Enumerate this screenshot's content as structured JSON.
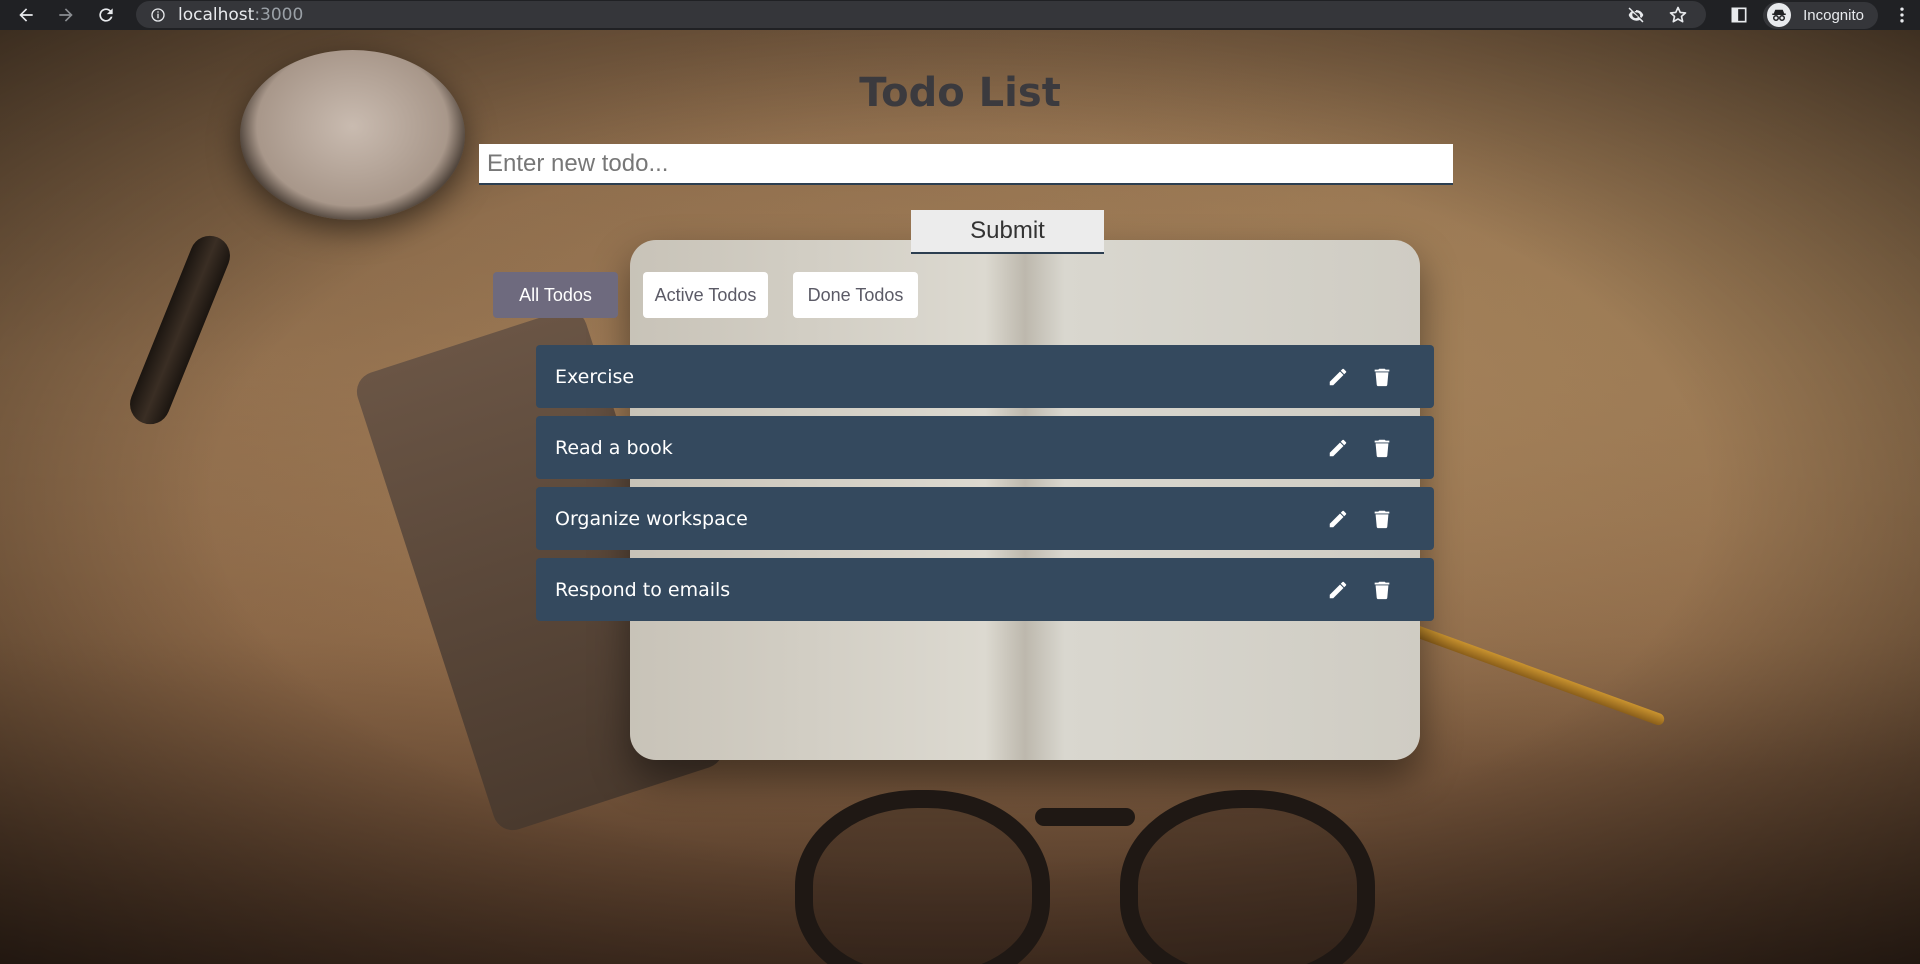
{
  "browser": {
    "url_host": "localhost",
    "url_port": ":3000",
    "profile_label": "Incognito"
  },
  "app": {
    "title": "Todo List",
    "input_placeholder": "Enter new todo...",
    "input_value": "",
    "submit_label": "Submit",
    "filters": [
      {
        "label": "All Todos",
        "active": true
      },
      {
        "label": "Active Todos",
        "active": false
      },
      {
        "label": "Done Todos",
        "active": false
      }
    ],
    "todos": [
      {
        "text": "Exercise"
      },
      {
        "text": "Read a book"
      },
      {
        "text": "Organize workspace"
      },
      {
        "text": "Respond to emails"
      }
    ],
    "item_icons": [
      "pencil-icon",
      "trash-icon"
    ]
  },
  "colors": {
    "todo_bg": "#34495e",
    "filter_active": "#6e6a7e",
    "title": "#3b3a3e"
  }
}
